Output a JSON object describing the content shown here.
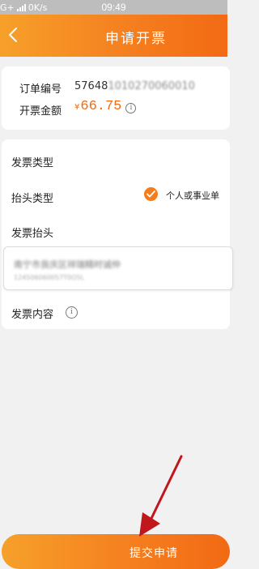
{
  "status_bar": {
    "network": "G+",
    "speed": "0K/s",
    "time": "09:49"
  },
  "header": {
    "title": "申请开票"
  },
  "order": {
    "order_no_label": "订单编号",
    "order_no_prefix": "57648",
    "order_no_rest": "1010270060010",
    "amount_label": "开票金额",
    "currency": "¥",
    "amount": "66.75"
  },
  "invoice": {
    "type_label": "发票类型",
    "header_type_label": "抬头类型",
    "header_type_option": "个人或事业单",
    "invoice_title_label": "发票抬头",
    "invoice_title_name": "南宁市良庆区祥瑞精时诚仲",
    "invoice_title_tax": "124506060057T0O5L",
    "content_label": "发票内容"
  },
  "submit": {
    "label": "提交申请"
  },
  "colors": {
    "accent": "#f57d1e",
    "accent_dark": "#f26a14",
    "annotation_arrow": "#c0161c"
  }
}
